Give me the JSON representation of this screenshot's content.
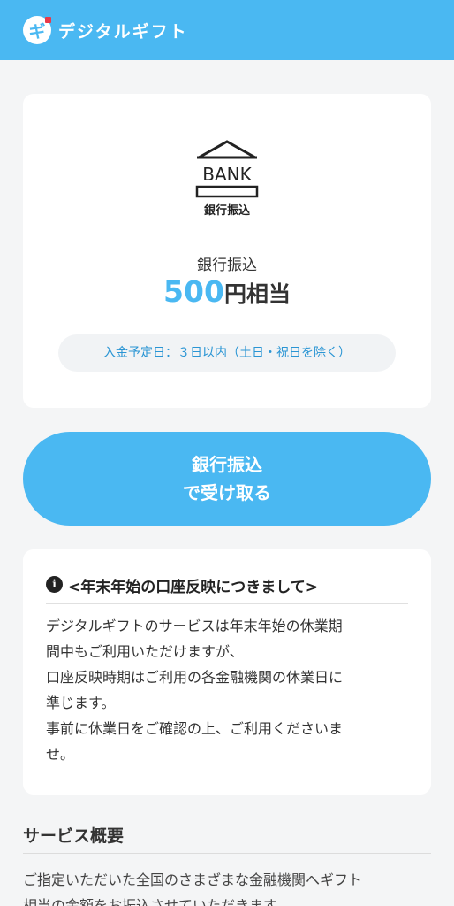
{
  "header": {
    "logo_char": "ギ",
    "app_name": "デジタルギフト"
  },
  "card": {
    "icon_text_top": "BANK",
    "icon_text_bottom": "銀行振込",
    "method_label": "銀行振込",
    "amount_value": "500",
    "amount_unit": "円相当",
    "deposit_note": "入金予定日：３日以内（土日・祝日を除く）"
  },
  "receive_button": {
    "line1": "銀行振込",
    "line2": "で受け取る"
  },
  "notice": {
    "icon_glyph": "i",
    "title": "<年末年始の口座反映につきまして>",
    "lines": [
      "デジタルギフトのサービスは年末年始の休業期",
      "間中もご利用いただけますが、",
      "口座反映時期はご利用の各金融機関の休業日に",
      "準じます。",
      "事前に休業日をご確認の上、ご利用くださいま",
      "せ。"
    ]
  },
  "service": {
    "title": "サービス概要",
    "lines": [
      "ご指定いただいた全国のさまざまな金融機関へギフト",
      "相当の金額をお振込させていただきます。"
    ]
  },
  "colors": {
    "brand": "#4ab8f2",
    "accent_text": "#2a95d4",
    "logo_dot": "#e83a4a"
  }
}
